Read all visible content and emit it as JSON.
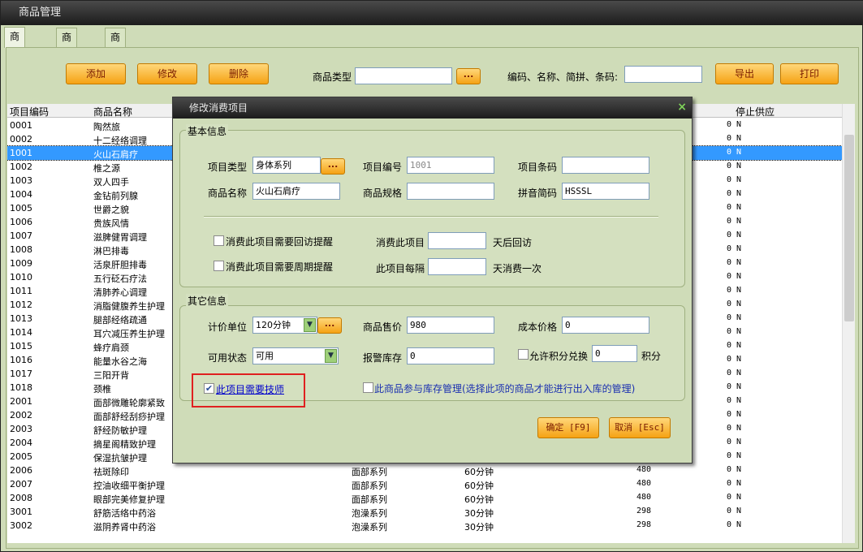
{
  "window": {
    "title": "商品管理"
  },
  "tabs": [
    "商品信息",
    "商品大类",
    "商品小类"
  ],
  "toolbar": {
    "add": "添加",
    "edit": "修改",
    "delete": "删除",
    "type_label": "商品类型",
    "type_value": "",
    "dots": "...",
    "search_label": "编码、名称、简拼、条码:",
    "search_value": "",
    "export": "导出",
    "print": "打印"
  },
  "grid": {
    "headers": {
      "code": "项目编码",
      "name": "商品名称",
      "stop": "停止供应"
    },
    "rows": [
      {
        "code": "0001",
        "name": "陶然旅",
        "type": "",
        "unit": "",
        "price": "",
        "qty": "0",
        "stop": "N"
      },
      {
        "code": "0002",
        "name": "十二经络调理",
        "type": "",
        "unit": "",
        "price": "",
        "qty": "0",
        "stop": "N"
      },
      {
        "code": "1001",
        "name": "火山石肩疗",
        "type": "",
        "unit": "",
        "price": "",
        "qty": "0",
        "stop": "N",
        "selected": true
      },
      {
        "code": "1002",
        "name": "椎之源",
        "type": "",
        "unit": "",
        "price": "",
        "qty": "0",
        "stop": "N"
      },
      {
        "code": "1003",
        "name": "双人四手",
        "type": "",
        "unit": "",
        "price": "",
        "qty": "0",
        "stop": "N"
      },
      {
        "code": "1004",
        "name": "金钻前列腺",
        "type": "",
        "unit": "",
        "price": "",
        "qty": "0",
        "stop": "N"
      },
      {
        "code": "1005",
        "name": "世爵之貌",
        "type": "",
        "unit": "",
        "price": "",
        "qty": "0",
        "stop": "N"
      },
      {
        "code": "1006",
        "name": "贵族风情",
        "type": "",
        "unit": "",
        "price": "",
        "qty": "0",
        "stop": "N"
      },
      {
        "code": "1007",
        "name": "滋脾健胃调理",
        "type": "",
        "unit": "",
        "price": "",
        "qty": "0",
        "stop": "N"
      },
      {
        "code": "1008",
        "name": "淋巴排毒",
        "type": "",
        "unit": "",
        "price": "",
        "qty": "0",
        "stop": "N"
      },
      {
        "code": "1009",
        "name": "活泉肝胆排毒",
        "type": "",
        "unit": "",
        "price": "",
        "qty": "0",
        "stop": "N"
      },
      {
        "code": "1010",
        "name": "五行砭石疗法",
        "type": "",
        "unit": "",
        "price": "",
        "qty": "0",
        "stop": "N"
      },
      {
        "code": "1011",
        "name": "清肺养心调理",
        "type": "",
        "unit": "",
        "price": "",
        "qty": "0",
        "stop": "N"
      },
      {
        "code": "1012",
        "name": "消脂健腹养生护理",
        "type": "",
        "unit": "",
        "price": "",
        "qty": "0",
        "stop": "N"
      },
      {
        "code": "1013",
        "name": "腿部经络疏通",
        "type": "",
        "unit": "",
        "price": "",
        "qty": "0",
        "stop": "N"
      },
      {
        "code": "1014",
        "name": "耳穴减压养生护理",
        "type": "",
        "unit": "",
        "price": "",
        "qty": "0",
        "stop": "N"
      },
      {
        "code": "1015",
        "name": "蜂疗肩颈",
        "type": "",
        "unit": "",
        "price": "",
        "qty": "0",
        "stop": "N"
      },
      {
        "code": "1016",
        "name": "能量水谷之海",
        "type": "",
        "unit": "",
        "price": "",
        "qty": "0",
        "stop": "N"
      },
      {
        "code": "1017",
        "name": "三阳开背",
        "type": "",
        "unit": "",
        "price": "",
        "qty": "0",
        "stop": "N"
      },
      {
        "code": "1018",
        "name": "颈椎",
        "type": "",
        "unit": "",
        "price": "",
        "qty": "0",
        "stop": "N"
      },
      {
        "code": "2001",
        "name": "面部微雕轮廓紧致",
        "type": "",
        "unit": "",
        "price": "",
        "qty": "0",
        "stop": "N"
      },
      {
        "code": "2002",
        "name": "面部舒经刮痧护理",
        "type": "",
        "unit": "",
        "price": "",
        "qty": "0",
        "stop": "N"
      },
      {
        "code": "2003",
        "name": "舒经防敏护理",
        "type": "",
        "unit": "",
        "price": "",
        "qty": "0",
        "stop": "N"
      },
      {
        "code": "2004",
        "name": "摘星阁精致护理",
        "type": "",
        "unit": "",
        "price": "",
        "qty": "0",
        "stop": "N"
      },
      {
        "code": "2005",
        "name": "保湿抗皱护理",
        "type": "",
        "unit": "",
        "price": "",
        "qty": "0",
        "stop": "N"
      },
      {
        "code": "2006",
        "name": "祛斑除印",
        "type": "面部系列",
        "unit": "60分钟",
        "price": "480",
        "qty": "0",
        "stop": "N"
      },
      {
        "code": "2007",
        "name": "控油收细平衡护理",
        "type": "面部系列",
        "unit": "60分钟",
        "price": "480",
        "qty": "0",
        "stop": "N"
      },
      {
        "code": "2008",
        "name": "眼部完美修复护理",
        "type": "面部系列",
        "unit": "60分钟",
        "price": "480",
        "qty": "0",
        "stop": "N"
      },
      {
        "code": "3001",
        "name": "舒筋活络中药浴",
        "type": "泡澡系列",
        "unit": "30分钟",
        "price": "298",
        "qty": "0",
        "stop": "N"
      },
      {
        "code": "3002",
        "name": "滋阴养肾中药浴",
        "type": "泡澡系列",
        "unit": "30分钟",
        "price": "298",
        "qty": "0",
        "stop": "N"
      }
    ]
  },
  "dialog": {
    "title": "修改消费项目",
    "close": "×",
    "basic_title": "基本信息",
    "item_type_label": "项目类型",
    "item_type_value": "身体系列",
    "item_code_label": "项目编号",
    "item_code_value": "1001",
    "barcode_label": "项目条码",
    "barcode_value": "",
    "name_label": "商品名称",
    "name_value": "火山石肩疗",
    "spec_label": "商品规格",
    "spec_value": "",
    "pinyin_label": "拼音简码",
    "pinyin_value": "HSSSL",
    "revisit_chk": "消费此项目需要回访提醒",
    "revisit_pre": "消费此项目",
    "revisit_value": "",
    "revisit_post": "天后回访",
    "cycle_chk": "消费此项目需要周期提醒",
    "cycle_pre": "此项目每隔",
    "cycle_value": "",
    "cycle_post": "天消费一次",
    "other_title": "其它信息",
    "unit_label": "计价单位",
    "unit_value": "120分钟",
    "price_label": "商品售价",
    "price_value": "980",
    "cost_label": "成本价格",
    "cost_value": "0",
    "status_label": "可用状态",
    "status_value": "可用",
    "alarm_label": "报警库存",
    "alarm_value": "0",
    "points_chk": "允许积分兑换",
    "points_value": "0",
    "points_unit": "积分",
    "tech_chk": "此项目需要技师",
    "stock_chk": "此商品参与库存管理(选择此项的商品才能进行出入库的管理)",
    "ok": "确定 [F9]",
    "cancel": "取消 [Esc]",
    "check_mark": "✔"
  }
}
